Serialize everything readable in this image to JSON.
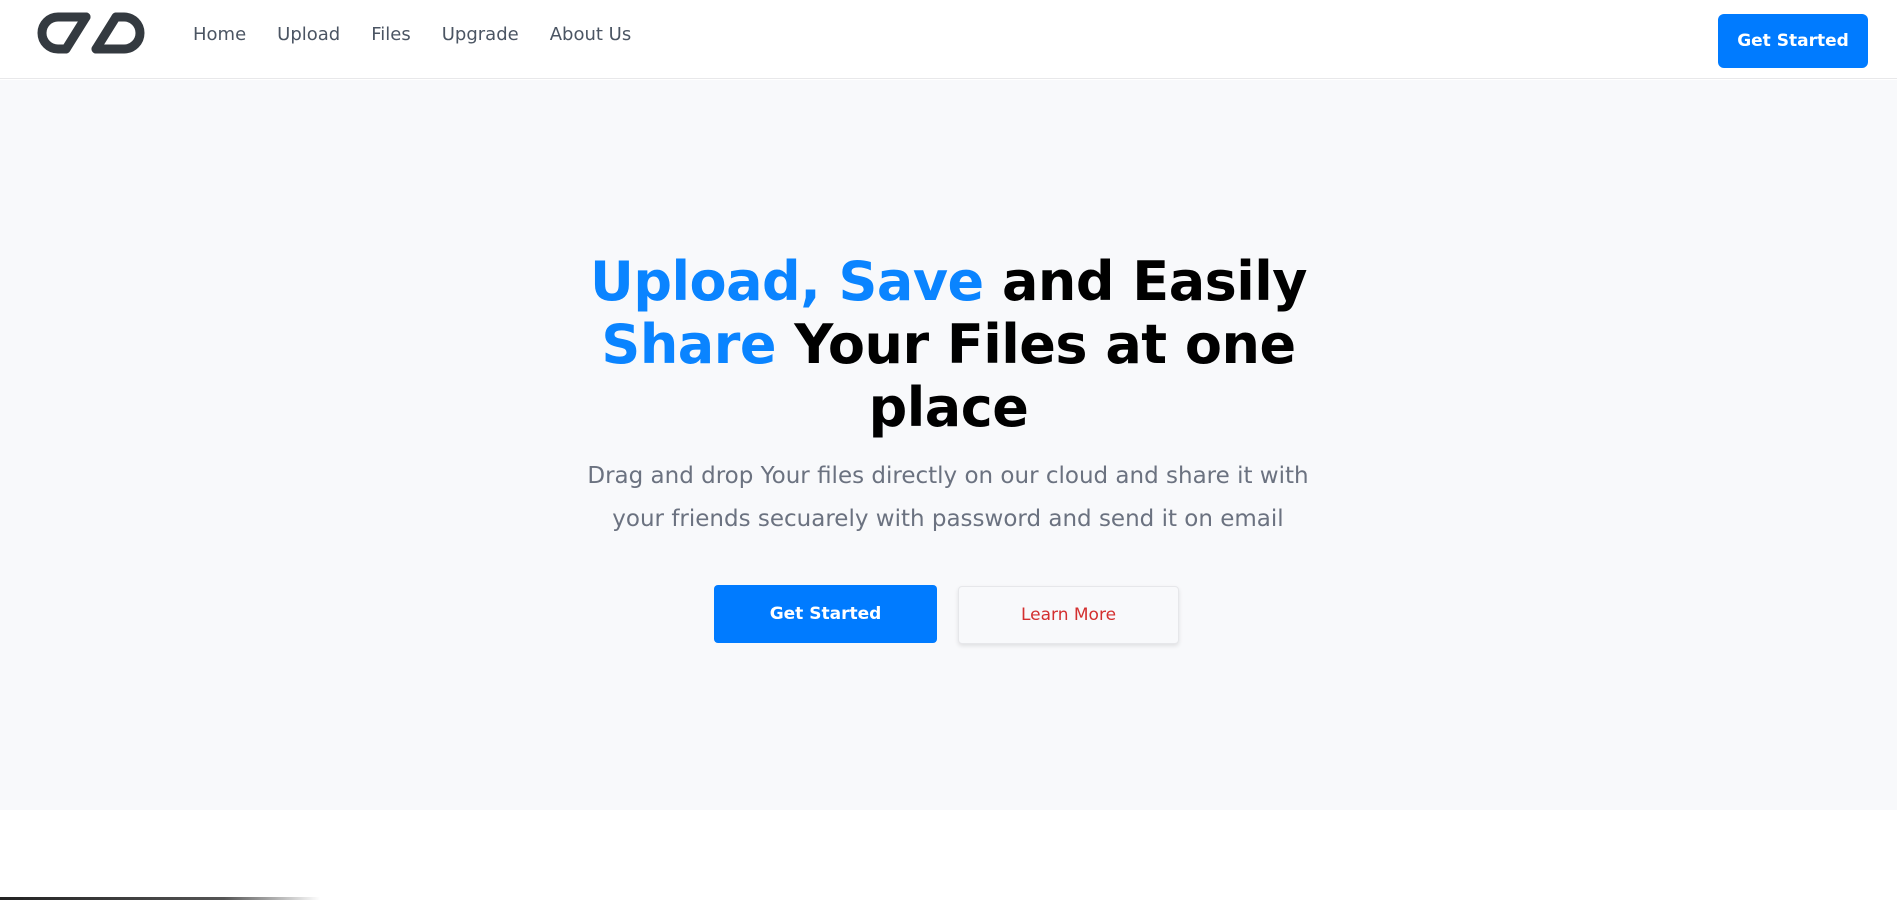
{
  "header": {
    "logo_icon": "chain-link-logo-icon",
    "nav": [
      {
        "label": "Home"
      },
      {
        "label": "Upload"
      },
      {
        "label": "Files"
      },
      {
        "label": "Upgrade"
      },
      {
        "label": "About Us"
      }
    ],
    "cta_label": "Get Started"
  },
  "hero": {
    "title_part1": "Upload, Save",
    "title_part2": " and Easily",
    "title_part3": "Share",
    "title_part4": " Your Files at one",
    "title_part5": "place",
    "subtitle_line1": "Drag and drop Your files directly on our cloud and share it with",
    "subtitle_line2": "your friends secuarely with password and send it on email",
    "primary_button": "Get Started",
    "secondary_button": "Learn More"
  },
  "colors": {
    "brand_blue": "#007bff",
    "accent_blue": "#0a84ff",
    "learn_more_red": "#d32f2f",
    "hero_bg": "#f8f9fb",
    "logo_dark": "#343a40"
  }
}
